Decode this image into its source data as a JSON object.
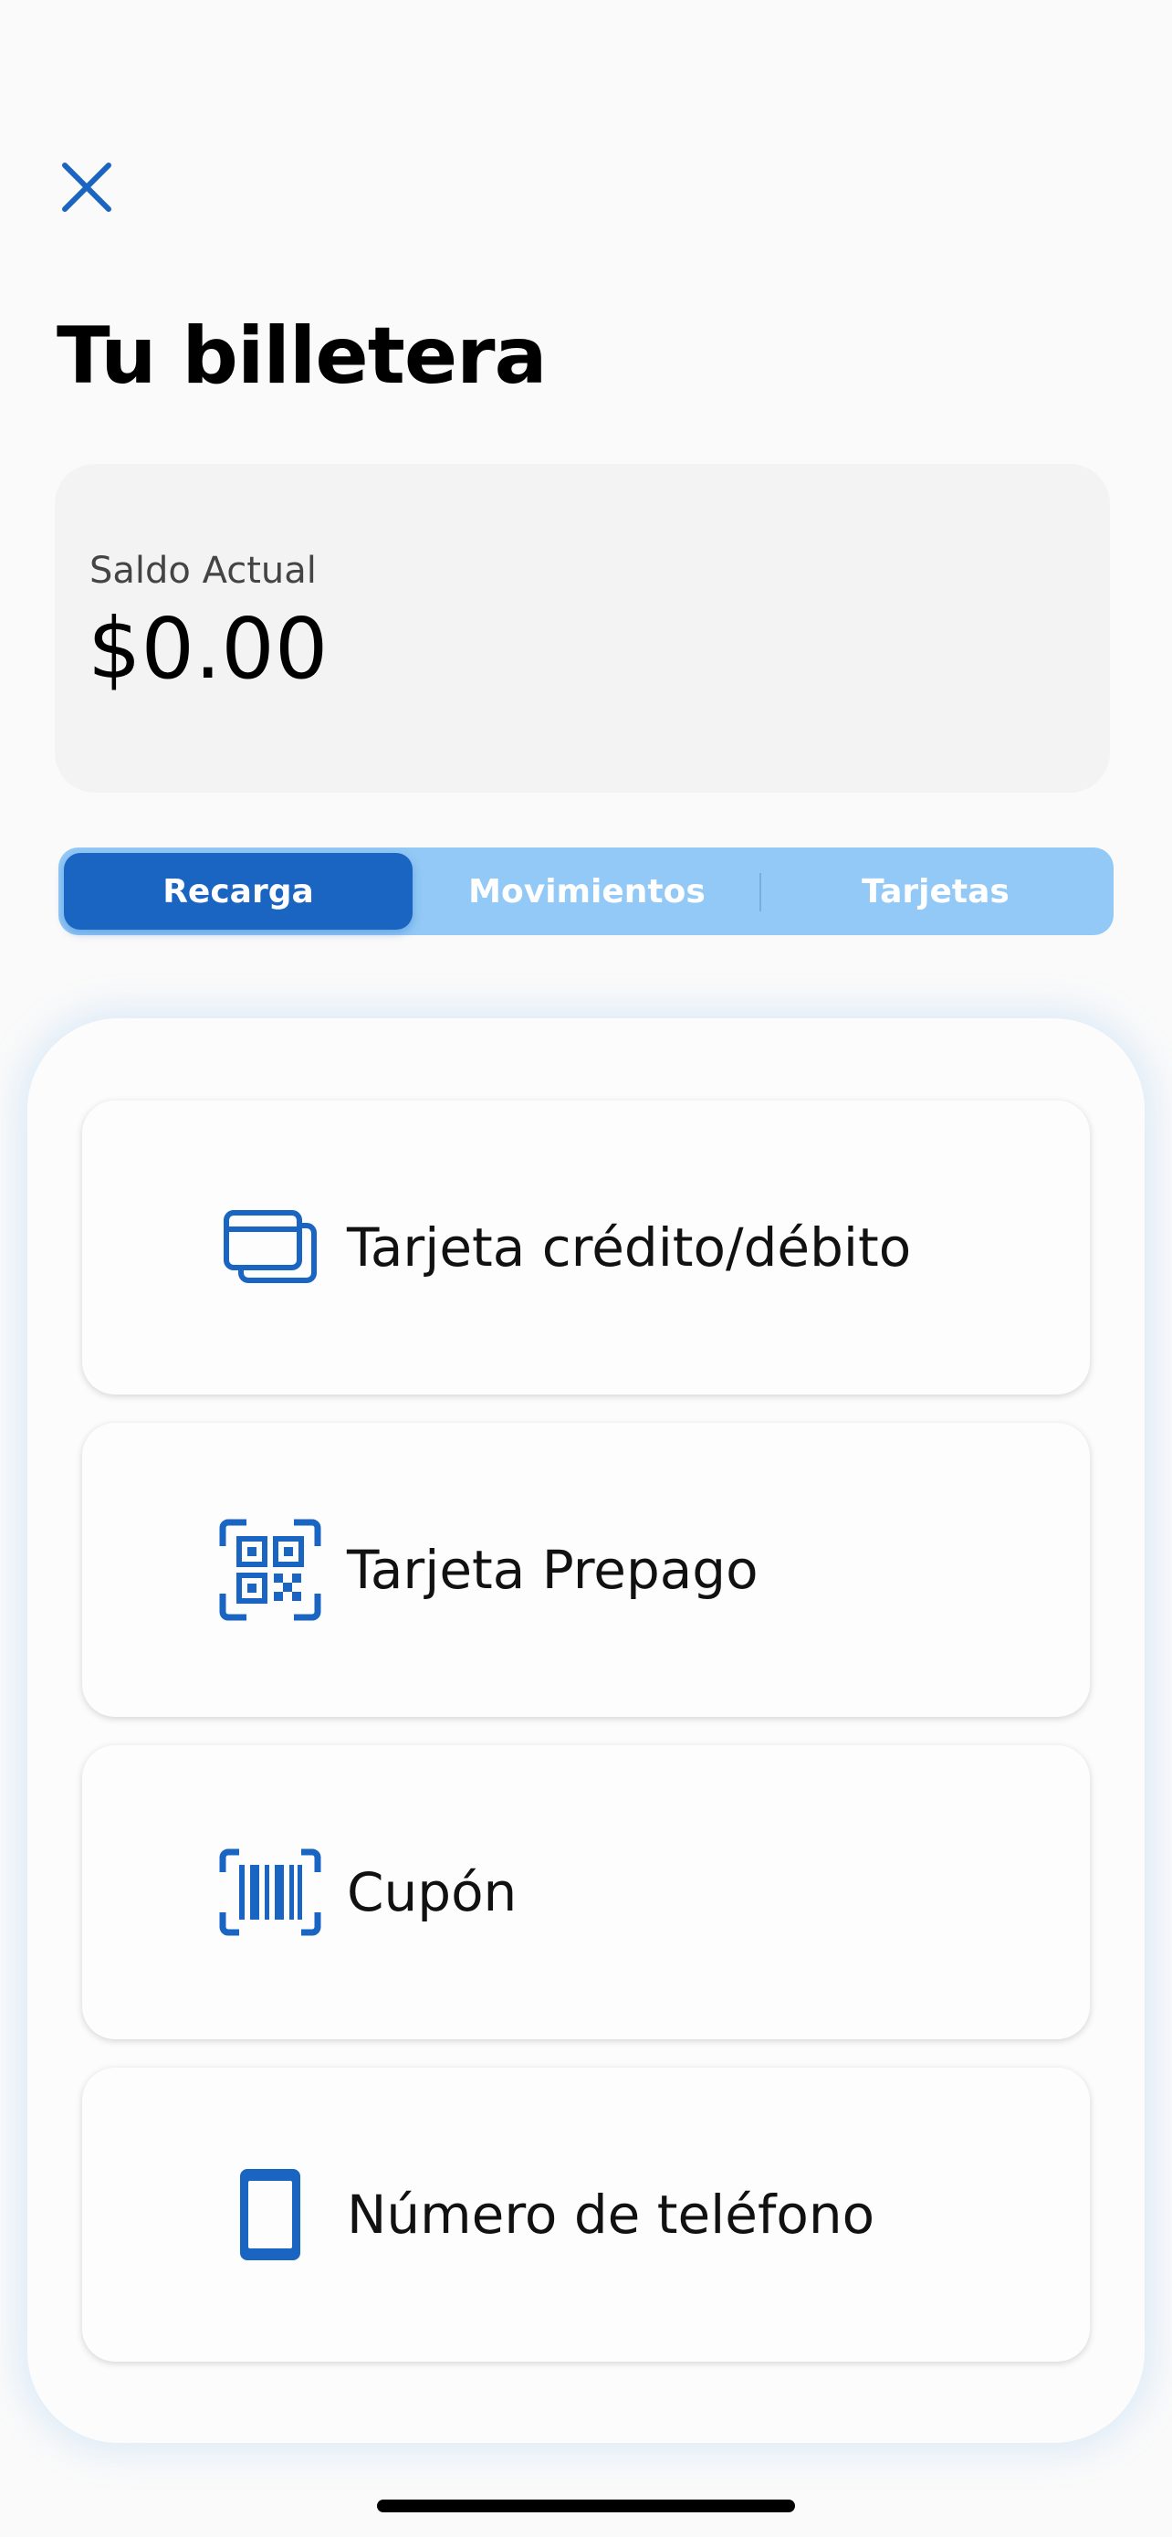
{
  "header": {
    "close_icon": "close-icon",
    "title": "Tu billetera"
  },
  "balance": {
    "label": "Saldo Actual",
    "value": "$0.00"
  },
  "tabs": [
    {
      "label": "Recarga",
      "selected": true
    },
    {
      "label": "Movimientos",
      "selected": false
    },
    {
      "label": "Tarjetas",
      "selected": false
    }
  ],
  "options": [
    {
      "label": "Tarjeta crédito/débito",
      "icon": "credit-cards-icon"
    },
    {
      "label": "Tarjeta Prepago",
      "icon": "qr-code-icon"
    },
    {
      "label": "Cupón",
      "icon": "barcode-icon"
    },
    {
      "label": "Número de teléfono",
      "icon": "phone-icon"
    }
  ],
  "colors": {
    "accent": "#1a64c2",
    "tab_bar": "#93c9f6",
    "card_background": "#f3f3f3"
  }
}
